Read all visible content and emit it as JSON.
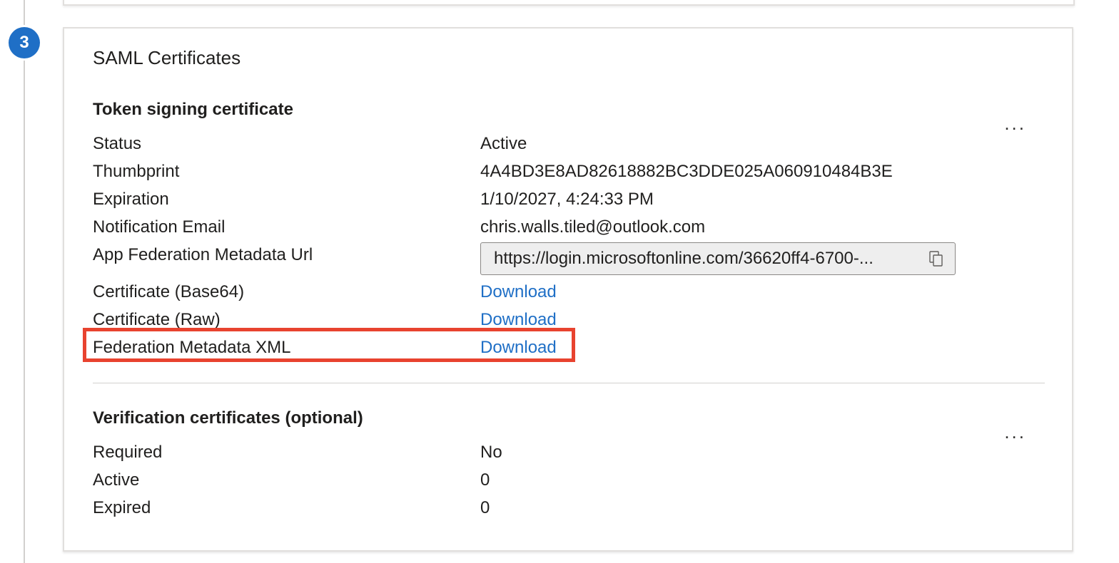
{
  "step": {
    "number": "3"
  },
  "card": {
    "title": "SAML Certificates"
  },
  "token_signing": {
    "title": "Token signing certificate",
    "more": "...",
    "rows": [
      {
        "label": "Status",
        "value": "Active"
      },
      {
        "label": "Thumbprint",
        "value": "4A4BD3E8AD82618882BC3DDE025A060910484B3E"
      },
      {
        "label": "Expiration",
        "value": "1/10/2027, 4:24:33 PM"
      },
      {
        "label": "Notification Email",
        "value": "chris.walls.tiled@outlook.com"
      }
    ],
    "metadata_url": {
      "label": "App Federation Metadata Url",
      "value": "https://login.microsoftonline.com/36620ff4-6700-..."
    },
    "downloads": [
      {
        "label": "Certificate (Base64)",
        "link": "Download"
      },
      {
        "label": "Certificate (Raw)",
        "link": "Download"
      },
      {
        "label": "Federation Metadata XML",
        "link": "Download"
      }
    ]
  },
  "verification": {
    "title": "Verification certificates (optional)",
    "more": "...",
    "rows": [
      {
        "label": "Required",
        "value": "No"
      },
      {
        "label": "Active",
        "value": "0"
      },
      {
        "label": "Expired",
        "value": "0"
      }
    ]
  },
  "colors": {
    "accent": "#1f6fc6",
    "highlight": "#e8432f"
  }
}
